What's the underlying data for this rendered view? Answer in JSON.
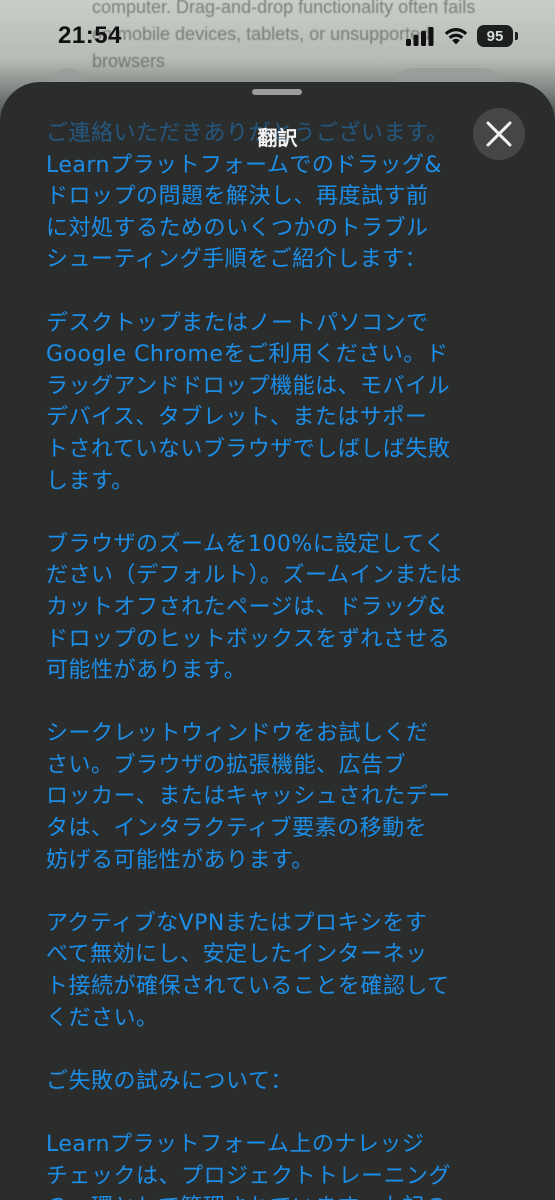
{
  "status_bar": {
    "time": "21:54",
    "battery_level": "95"
  },
  "background_page": {
    "text": "computer. Drag-and-drop functionality often fails\non mobile devices, tablets, or unsupported\nbrowsers"
  },
  "sheet": {
    "title": "翻訳",
    "paragraphs": [
      "ご連絡いただきありがとうございます。",
      "Learnプラットフォームでのドラッグ&\nドロップの問題を解決し、再度試す前\nに対処するためのいくつかのトラブル\nシューティング手順をご紹介します：",
      "デスクトップまたはノートパソコンで\nGoogle Chromeをご利用ください。ド\nラッグアンドドロップ機能は、モバイル\nデバイス、タブレット、またはサポー\nトされていないブラウザでしばしば失敗\nします。",
      "ブラウザのズームを100%に設定してく\nださい（デフォルト）。ズームインまたは\nカットオフされたページは、ドラッグ&\nドロップのヒットボックスをずれさせる\n可能性があります。",
      "シークレットウィンドウをお試しくだ\nさい。ブラウザの拡張機能、広告ブ\nロッカー、またはキャッシュされたデー\nタは、インタラクティブ要素の移動を\n妨げる可能性があります。",
      "アクティブなVPNまたはプロキシをす\nべて無効にし、安定したインターネッ\nト接続が確保されていることを確認して\nください。",
      "ご失敗の試みについて：",
      "Learnプラットフォーム上のナレッジ\nチェックは、プロジェクトトレーニング\nの一環として管理されています。上記の"
    ]
  },
  "colors": {
    "sheet_background": "#2b2d2c",
    "text_accent": "#1d8ee8",
    "close_button_bg": "#454746"
  },
  "icons": {
    "close": "close-icon",
    "signal": "cellular-signal-icon",
    "wifi": "wifi-icon",
    "battery": "battery-icon"
  }
}
